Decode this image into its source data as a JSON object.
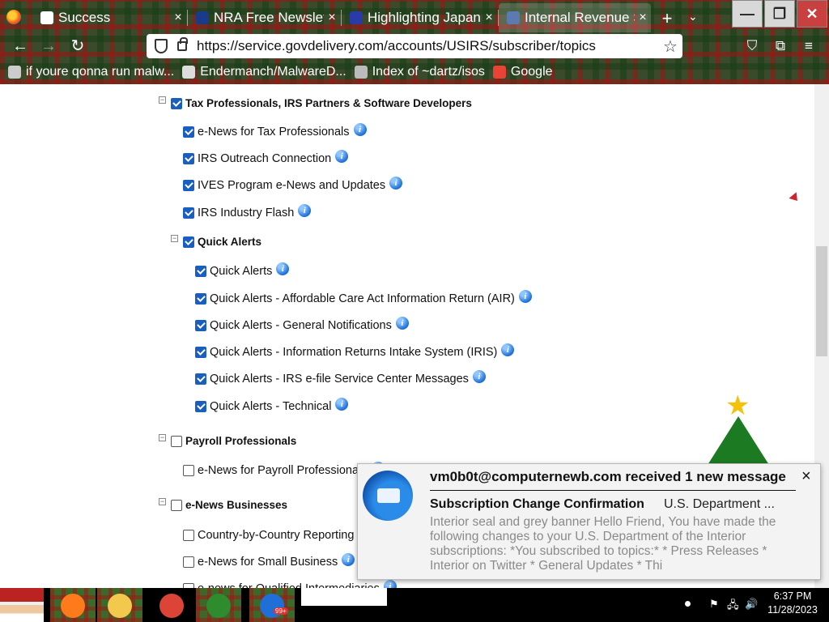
{
  "browser": {
    "tabs": [
      {
        "title": "Success",
        "favicon_color": "#ffffff",
        "active": false
      },
      {
        "title": "NRA Free Newsletter",
        "favicon_color": "#1a3a8a",
        "active": false
      },
      {
        "title": "Highlighting Japan",
        "favicon_color": "#2a3aa8",
        "active": false
      },
      {
        "title": "Internal Revenue S",
        "favicon_color": "#5a7ab0",
        "active": true
      }
    ],
    "close_glyph": "×",
    "new_tab_glyph": "+",
    "tab_list_glyph": "⌄",
    "window_controls": {
      "minimize": "—",
      "restore": "❐",
      "close": "✕"
    },
    "nav": {
      "back": "←",
      "forward": "→",
      "reload": "↻"
    },
    "url": "https://service.govdelivery.com/accounts/USIRS/subscriber/topics",
    "bookmark_star": "☆",
    "right_icons": {
      "pocket": "⛉",
      "extensions": "⧉",
      "menu": "≡"
    },
    "bookmarks": [
      {
        "label": "if youre qonna run malw...",
        "icon_color": "#cccccc"
      },
      {
        "label": "Endermanch/MalwareD...",
        "icon_color": "#dddddd"
      },
      {
        "label": "Index of ~dartz/isos",
        "icon_color": "#bbbbbb"
      },
      {
        "label": "Google",
        "icon_color": "#ea4335"
      }
    ]
  },
  "topics": [
    {
      "label": "Tax Professionals, IRS Partners & Software Developers",
      "checked": true,
      "group": true,
      "level": 0,
      "info": false
    },
    {
      "label": "e-News for Tax Professionals",
      "checked": true,
      "group": false,
      "level": 1,
      "info": true
    },
    {
      "label": "IRS Outreach Connection",
      "checked": true,
      "group": false,
      "level": 1,
      "info": true
    },
    {
      "label": "IVES Program e-News and Updates",
      "checked": true,
      "group": false,
      "level": 1,
      "info": true
    },
    {
      "label": "IRS Industry Flash",
      "checked": true,
      "group": false,
      "level": 1,
      "info": true
    },
    {
      "label": "Quick Alerts",
      "checked": true,
      "group": true,
      "level": 1,
      "info": false
    },
    {
      "label": "Quick Alerts",
      "checked": true,
      "group": false,
      "level": 2,
      "info": true
    },
    {
      "label": "Quick Alerts - Affordable Care Act Information Return (AIR)",
      "checked": true,
      "group": false,
      "level": 2,
      "info": true
    },
    {
      "label": "Quick Alerts - General Notifications",
      "checked": true,
      "group": false,
      "level": 2,
      "info": true
    },
    {
      "label": "Quick Alerts - Information Returns Intake System (IRIS)",
      "checked": true,
      "group": false,
      "level": 2,
      "info": true
    },
    {
      "label": "Quick Alerts - IRS e-file Service Center Messages",
      "checked": true,
      "group": false,
      "level": 2,
      "info": true
    },
    {
      "label": "Quick Alerts - Technical",
      "checked": true,
      "group": false,
      "level": 2,
      "info": true
    },
    {
      "label": "Payroll Professionals",
      "checked": false,
      "group": true,
      "level": 0,
      "info": false
    },
    {
      "label": "e-News for Payroll Professionals",
      "checked": false,
      "group": false,
      "level": 1,
      "info": true
    },
    {
      "label": "e-News Businesses",
      "checked": false,
      "group": true,
      "level": 0,
      "info": false
    },
    {
      "label": "Country-by-Country Reporting",
      "checked": false,
      "group": false,
      "level": 1,
      "info": true
    },
    {
      "label": "e-News for Small Business",
      "checked": false,
      "group": false,
      "level": 1,
      "info": true
    },
    {
      "label": "e-news for Qualified Intermediaries",
      "checked": false,
      "group": false,
      "level": 1,
      "info": true
    }
  ],
  "collapse_glyph": "−",
  "info_glyph": "i",
  "notification": {
    "header": "vm0b0t@computernewb.com received 1 new message",
    "close": "×",
    "subject": "Subscription Change Confirmation",
    "from": "U.S. Department ...",
    "body": "Interior seal and grey banner Hello Friend, You have made the following changes to your U.S. Department of the Interior subscriptions: *You subscribed to topics:* * Press Releases * Interior on Twitter * General Updates * Thi"
  },
  "taskbar": {
    "apps": [
      {
        "name": "firefox",
        "color": "#ff7a1a"
      },
      {
        "name": "file-explorer",
        "color": "#f2c94c"
      },
      {
        "name": "chrome",
        "color": "#db4437"
      },
      {
        "name": "christmas-tree",
        "color": "#2e8b2e"
      },
      {
        "name": "thunderbird",
        "color": "#1f6fd6"
      }
    ],
    "thunderbird_badge": "99+",
    "clock_time": "6:37 PM",
    "clock_date": "11/28/2023"
  }
}
